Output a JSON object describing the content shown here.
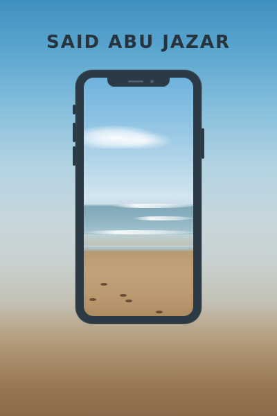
{
  "header": {
    "title": "SAID ABU JAZAR"
  },
  "colors": {
    "title": "#28343d",
    "phone_frame": "#2b3a45"
  },
  "phone": {
    "screen_image": "beach-shoreline-photo"
  }
}
